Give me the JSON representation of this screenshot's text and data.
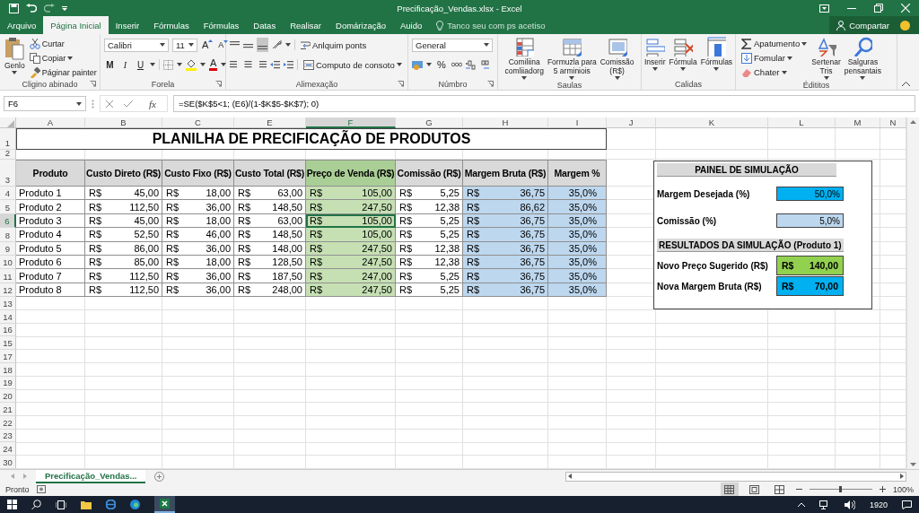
{
  "window": {
    "title": "Precificação_Vendas.xlsx  -  Excel"
  },
  "tabs": [
    {
      "label": "Arquivo",
      "selected": false
    },
    {
      "label": "Página Inicial",
      "selected": true
    },
    {
      "label": "Inserir",
      "selected": false
    },
    {
      "label": "Fórmulas",
      "selected": false
    },
    {
      "label": "Fórmulas",
      "selected": false
    },
    {
      "label": "Datas",
      "selected": false
    },
    {
      "label": "Realisar",
      "selected": false
    },
    {
      "label": "Domárização",
      "selected": false
    },
    {
      "label": "Auido",
      "selected": false
    }
  ],
  "search": {
    "placeholder": "Tanco seu com ps acetiso"
  },
  "share": {
    "label": "Compartar"
  },
  "ribbon": {
    "groups": [
      {
        "name": "Cligino abinado",
        "kind": "clipboard",
        "large": "Genlo",
        "items": [
          "Curtar",
          "Copiar",
          "Páginar painter"
        ]
      },
      {
        "name": "Forela",
        "kind": "font",
        "font": "Calibri",
        "size": "11",
        "grow": "A",
        "shrink": "A",
        "styles": [
          "M",
          "I",
          "U"
        ],
        "color_letter": "A"
      },
      {
        "name": "Alimexação",
        "kind": "align",
        "items": [
          "Anlquim ponts",
          "Computo de consoto"
        ]
      },
      {
        "name": "Númbro",
        "kind": "number",
        "format": "General",
        "percent": "%"
      },
      {
        "name": "Saulas",
        "kind": "large",
        "items": [
          {
            "kind": "conditional",
            "lines": [
              "Comiliina",
              "comliiadorg"
            ]
          },
          {
            "kind": "table",
            "lines": [
              "Formuzla para",
              "5 arminiois"
            ]
          },
          {
            "kind": "cellstyle",
            "lines": [
              "Comissão",
              "(R$)"
            ]
          }
        ]
      },
      {
        "name": "Calidas",
        "kind": "large",
        "items": [
          {
            "kind": "insert",
            "lines": [
              "Inserir"
            ]
          },
          {
            "kind": "delete",
            "lines": [
              "Fórmula"
            ]
          },
          {
            "kind": "format",
            "lines": [
              "Fórmulas"
            ]
          }
        ]
      },
      {
        "name": "Édititos",
        "kind": "editing",
        "items": [
          "Apatumento",
          "Fomular",
          "Chater"
        ],
        "large": [
          {
            "kind": "sort",
            "lines": [
              "Sertenar",
              "Tris"
            ]
          },
          {
            "kind": "find",
            "lines": [
              "Salguras",
              "pensantais"
            ]
          }
        ]
      }
    ]
  },
  "formula_bar": {
    "name_box": "F6",
    "fx": "fx",
    "formula": "=SE($K$5<1; (E6)/(1-$K$5-$K$7); 0)"
  },
  "sheet": {
    "columns": [
      {
        "label": "A",
        "selected": false
      },
      {
        "label": "B",
        "selected": false
      },
      {
        "label": "C",
        "selected": false
      },
      {
        "label": "E",
        "selected": false
      },
      {
        "label": "F",
        "selected": true
      },
      {
        "label": "G",
        "selected": false
      },
      {
        "label": "H",
        "selected": false
      },
      {
        "label": "I",
        "selected": false
      },
      {
        "label": "J",
        "selected": false
      },
      {
        "label": "K",
        "selected": false
      },
      {
        "label": "L",
        "selected": false
      },
      {
        "label": "M",
        "selected": false
      },
      {
        "label": "N",
        "selected": false
      }
    ],
    "title_row": "1",
    "title": "PLANILHA DE PRECIFICAÇÃO DE PRODUTOS",
    "blank_row": "2",
    "header_row": "3",
    "empty_rows": [
      "13",
      "14",
      "16",
      "15",
      "17",
      "18",
      "19",
      "20",
      "21",
      "22",
      "23",
      "24",
      "30"
    ]
  },
  "table": {
    "columns": [
      {
        "header": "Produto",
        "kind": "text"
      },
      {
        "header": "Custo Direto (R$)",
        "kind": "currency"
      },
      {
        "header": "Custo Fixo (R$)",
        "kind": "currency"
      },
      {
        "header": "Custo Total (R$)",
        "kind": "currency"
      },
      {
        "header": "Preço de Venda (R$)",
        "kind": "currency",
        "color": "#c6e0b4",
        "header_tinted": true
      },
      {
        "header": "Comissão (R$)",
        "kind": "currency"
      },
      {
        "header": "Margem Bruta (R$)",
        "kind": "currency",
        "color": "#bdd7ee"
      },
      {
        "header": "Margem %",
        "kind": "percent",
        "color": "#bdd7ee"
      }
    ],
    "rows": [
      {
        "label": "4",
        "selected": false,
        "cells": [
          "Produto 1",
          "R$ 45,00",
          "R$ 18,00",
          "R$ 63,00",
          "R$ 105,00",
          "R$ 5,25",
          "R$ 36,75",
          "35,0%"
        ]
      },
      {
        "label": "5",
        "selected": false,
        "cells": [
          "Produto 2",
          "R$ 112,50",
          "R$ 36,00",
          "R$ 148,50",
          "R$ 247,50",
          "R$ 12,38",
          "R$ 86,62",
          "35,0%"
        ]
      },
      {
        "label": "6",
        "selected": true,
        "cells": [
          "Produto 3",
          "R$ 45,00",
          "R$ 18,00",
          "R$ 63,00",
          "R$ 105,00",
          "R$ 5,25",
          "R$ 36,75",
          "35,0%"
        ]
      },
      {
        "label": "8",
        "selected": false,
        "cells": [
          "Produto 4",
          "R$ 52,50",
          "R$ 46,00",
          "R$ 148,50",
          "R$ 105,00",
          "R$ 5,25",
          "R$ 36,75",
          "35,0%"
        ]
      },
      {
        "label": "9",
        "selected": false,
        "cells": [
          "Produto 5",
          "R$ 86,00",
          "R$ 36,00",
          "R$ 148,00",
          "R$ 247,50",
          "R$ 12,38",
          "R$ 36,75",
          "35,0%"
        ]
      },
      {
        "label": "10",
        "selected": false,
        "cells": [
          "Produto 6",
          "R$ 85,00",
          "R$ 18,00",
          "R$ 128,50",
          "R$ 247,50",
          "R$ 12,38",
          "R$ 36,75",
          "35,0%"
        ]
      },
      {
        "label": "11",
        "selected": false,
        "cells": [
          "Produto 7",
          "R$ 112,50",
          "R$ 36,00",
          "R$ 187,50",
          "R$ 247,00",
          "R$ 5,25",
          "R$ 36,75",
          "35,0%"
        ]
      },
      {
        "label": "12",
        "selected": false,
        "cells": [
          "Produto 8",
          "R$ 112,50",
          "R$ 36,00",
          "R$ 248,00",
          "R$ 247,50",
          "R$ 5,25",
          "R$ 36,75",
          "35,0%"
        ]
      }
    ]
  },
  "panel": {
    "title": "PAINEL DE SIMULAÇÃO",
    "inputs": [
      {
        "label": "Margem Desejada (%)",
        "value": "50,0%",
        "color": "#00b0f0"
      },
      {
        "label": "Comissão (%)",
        "value": "5,0%",
        "color": "#bdd7ee"
      }
    ],
    "results_title": "RESULTADOS DA SIMULAÇÃO (Produto 1)",
    "results": [
      {
        "label": "Novo Preço Sugerido (R$)",
        "value": "R$ 140,00",
        "color": "#92d050"
      },
      {
        "label": "Nova Margem Bruta (R$)",
        "value": "R$ 70,00",
        "color": "#00b0f0"
      }
    ]
  },
  "sheet_tabs": [
    {
      "label": "Precificação_Vendas...",
      "selected": true
    }
  ],
  "status_bar": {
    "text": "Pronto",
    "views": [
      {
        "kind": "normal",
        "selected": true
      },
      {
        "kind": "layout",
        "selected": false
      },
      {
        "kind": "break",
        "selected": false
      }
    ],
    "zoom": {
      "level": 0.5,
      "label": "100%"
    }
  },
  "taskbar": {
    "tray_text": "1920"
  }
}
